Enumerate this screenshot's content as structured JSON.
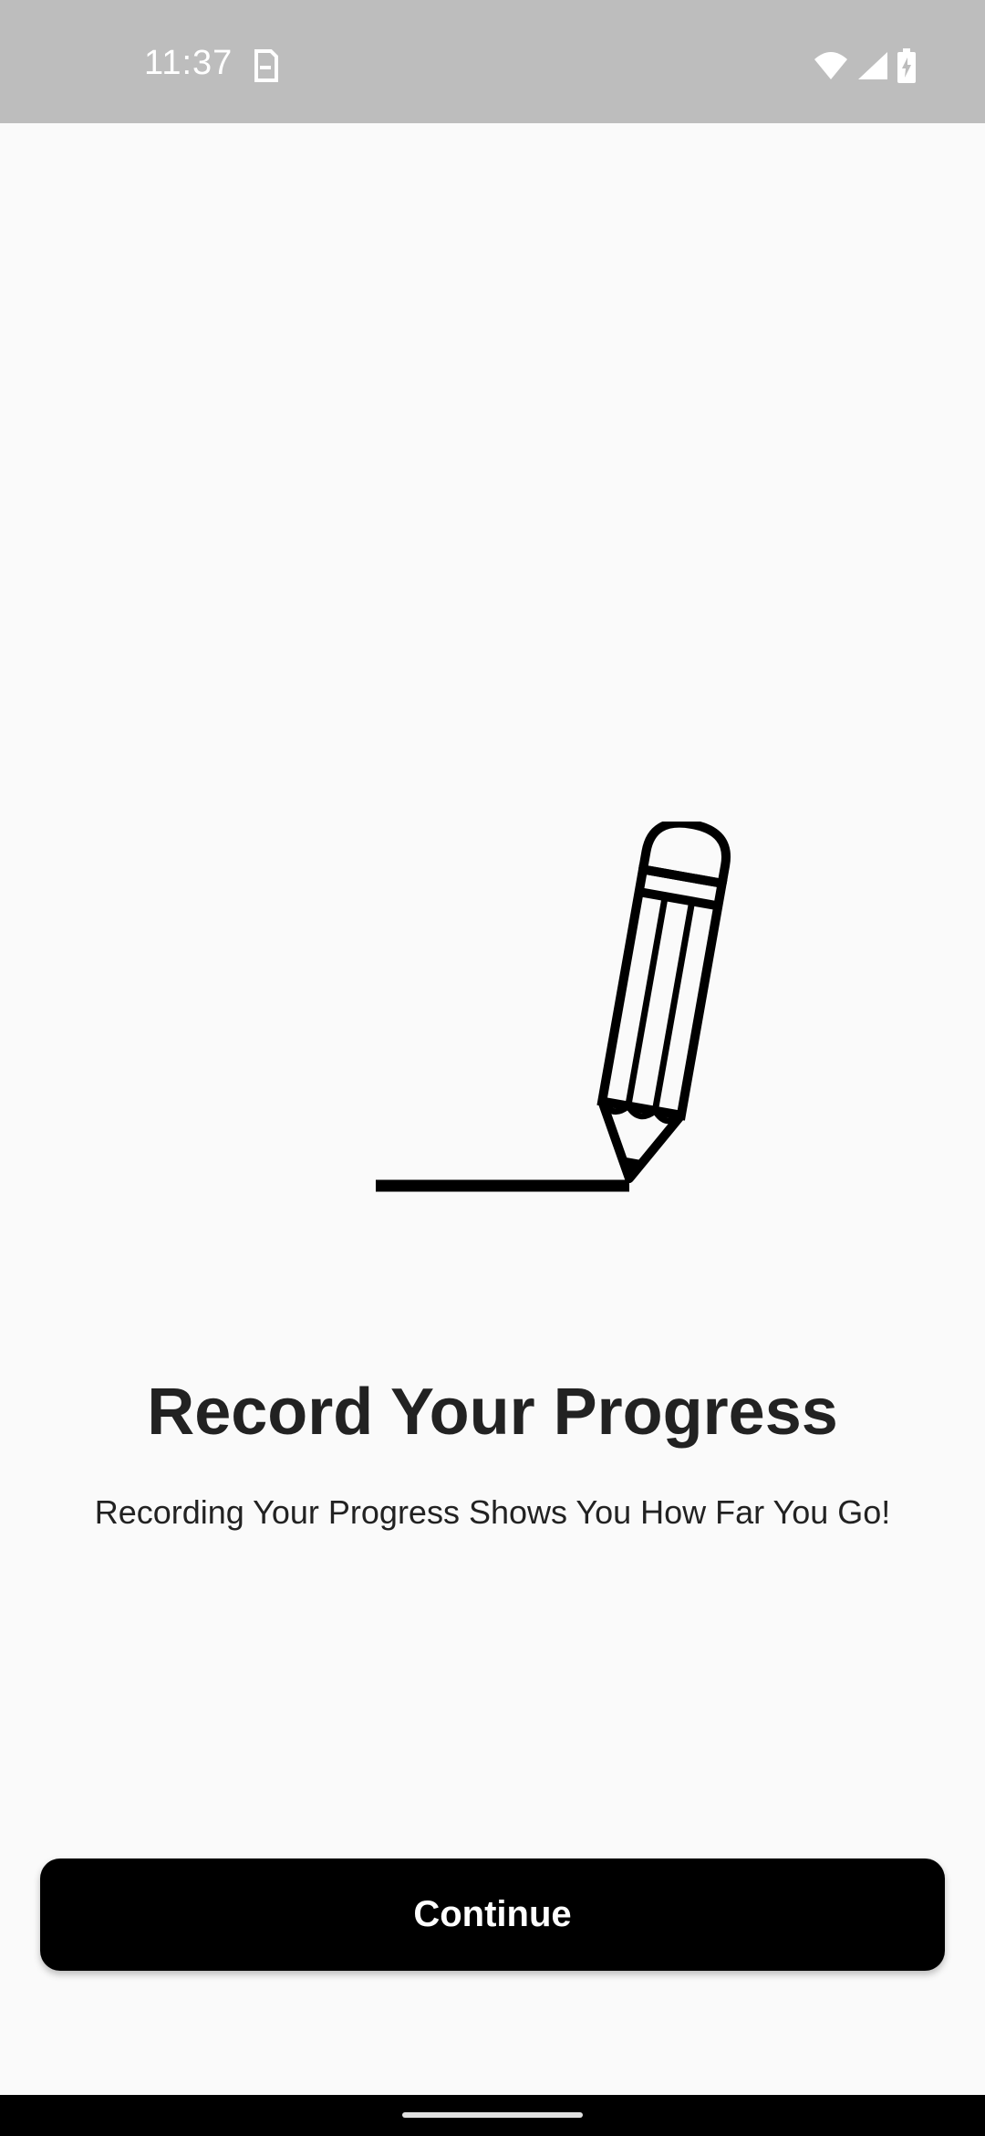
{
  "status_bar": {
    "time": "11:37",
    "icons": [
      "sim-card-icon",
      "wifi-icon",
      "signal-icon",
      "battery-charging-icon"
    ]
  },
  "onboarding": {
    "illustration": "pencil-writing-icon",
    "title": "Record Your Progress",
    "subtitle": "Recording Your Progress Shows You How Far You Go!",
    "continue_label": "Continue"
  },
  "colors": {
    "background": "#fafafa",
    "status_bar": "#bdbdbd",
    "button": "#000000",
    "button_text": "#ffffff",
    "text": "#222222"
  }
}
